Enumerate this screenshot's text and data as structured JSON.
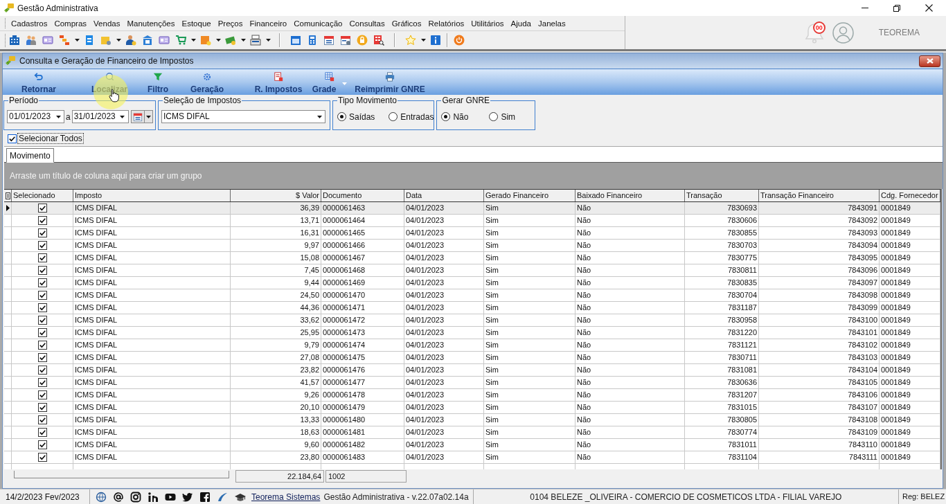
{
  "window": {
    "title": "Gestão Administrativa"
  },
  "menu": [
    "Cadastros",
    "Compras",
    "Vendas",
    "Manutenções",
    "Estoque",
    "Preços",
    "Financeiro",
    "Comunicação",
    "Consultas",
    "Gráficos",
    "Relatórios",
    "Utilitários",
    "Ajuda",
    "Janelas"
  ],
  "notifications": {
    "badge": "00"
  },
  "user": {
    "name": "TEOREMA"
  },
  "form": {
    "title": "Consulta e Geração de Financeiro de Impostos"
  },
  "ribbon": [
    {
      "label": "Retornar",
      "kind": "button"
    },
    {
      "label": "Localizar",
      "kind": "button"
    },
    {
      "label": "Filtro",
      "kind": "button"
    },
    {
      "label": "Geração",
      "kind": "button"
    },
    {
      "label": "R. Impostos",
      "kind": "button"
    },
    {
      "label": "Grade",
      "kind": "dropdown"
    },
    {
      "label": "Reimprimir GNRE",
      "kind": "button"
    }
  ],
  "filters": {
    "period": {
      "label": "Período",
      "from": "01/01/2023",
      "separator": "a",
      "to": "31/01/2023"
    },
    "tax_selection": {
      "label": "Seleção de Impostos",
      "value": "ICMS DIFAL"
    },
    "movement_type": {
      "label": "Tipo Movimento",
      "options": [
        {
          "label": "Saídas",
          "selected": true
        },
        {
          "label": "Entradas",
          "selected": false
        }
      ]
    },
    "generate_gnre": {
      "label": "Gerar GNRE",
      "options": [
        {
          "label": "Não",
          "selected": true
        },
        {
          "label": "Sim",
          "selected": false
        }
      ]
    }
  },
  "select_all": {
    "label": "Selecionar Todos",
    "checked": true
  },
  "tabs": [
    {
      "label": "Movimento",
      "selected": true
    }
  ],
  "group_panel": {
    "hint": "Arraste um título de coluna aqui para criar um grupo"
  },
  "table": {
    "checkbox_column": {
      "label": "Selecionado"
    },
    "columns": [
      {
        "label": "Imposto",
        "kind": "text"
      },
      {
        "label": "$ Valor",
        "kind": "money"
      },
      {
        "label": "Documento",
        "kind": "text"
      },
      {
        "label": "Data",
        "kind": "text"
      },
      {
        "label": "Gerado Financeiro",
        "kind": "text"
      },
      {
        "label": "Baixado Financeiro",
        "kind": "text"
      },
      {
        "label": "Transação",
        "kind": "number"
      },
      {
        "label": "Transação Financeiro",
        "kind": "number"
      },
      {
        "label": "Cdg. Fornecedor",
        "kind": "text"
      }
    ],
    "rows": [
      {
        "selected": true,
        "checked": true,
        "cells": [
          "ICMS DIFAL",
          "36,39",
          "0000061463",
          "04/01/2023",
          "Sim",
          "Não",
          "7830693",
          "7843091",
          "0001849"
        ]
      },
      {
        "selected": false,
        "checked": true,
        "cells": [
          "ICMS DIFAL",
          "13,71",
          "0000061464",
          "04/01/2023",
          "Sim",
          "Não",
          "7830606",
          "7843092",
          "0001849"
        ]
      },
      {
        "selected": false,
        "checked": true,
        "cells": [
          "ICMS DIFAL",
          "16,31",
          "0000061465",
          "04/01/2023",
          "Sim",
          "Não",
          "7830855",
          "7843093",
          "0001849"
        ]
      },
      {
        "selected": false,
        "checked": true,
        "cells": [
          "ICMS DIFAL",
          "9,97",
          "0000061466",
          "04/01/2023",
          "Sim",
          "Não",
          "7830703",
          "7843094",
          "0001849"
        ]
      },
      {
        "selected": false,
        "checked": true,
        "cells": [
          "ICMS DIFAL",
          "15,08",
          "0000061467",
          "04/01/2023",
          "Sim",
          "Não",
          "7830775",
          "7843095",
          "0001849"
        ]
      },
      {
        "selected": false,
        "checked": true,
        "cells": [
          "ICMS DIFAL",
          "7,45",
          "0000061468",
          "04/01/2023",
          "Sim",
          "Não",
          "7830811",
          "7843096",
          "0001849"
        ]
      },
      {
        "selected": false,
        "checked": true,
        "cells": [
          "ICMS DIFAL",
          "9,44",
          "0000061469",
          "04/01/2023",
          "Sim",
          "Não",
          "7830835",
          "7843097",
          "0001849"
        ]
      },
      {
        "selected": false,
        "checked": true,
        "cells": [
          "ICMS DIFAL",
          "24,50",
          "0000061470",
          "04/01/2023",
          "Sim",
          "Não",
          "7830704",
          "7843098",
          "0001849"
        ]
      },
      {
        "selected": false,
        "checked": true,
        "cells": [
          "ICMS DIFAL",
          "44,36",
          "0000061471",
          "04/01/2023",
          "Sim",
          "Não",
          "7831187",
          "7843099",
          "0001849"
        ]
      },
      {
        "selected": false,
        "checked": true,
        "cells": [
          "ICMS DIFAL",
          "33,62",
          "0000061472",
          "04/01/2023",
          "Sim",
          "Não",
          "7830958",
          "7843100",
          "0001849"
        ]
      },
      {
        "selected": false,
        "checked": true,
        "cells": [
          "ICMS DIFAL",
          "25,95",
          "0000061473",
          "04/01/2023",
          "Sim",
          "Não",
          "7831220",
          "7843101",
          "0001849"
        ]
      },
      {
        "selected": false,
        "checked": true,
        "cells": [
          "ICMS DIFAL",
          "9,79",
          "0000061474",
          "04/01/2023",
          "Sim",
          "Não",
          "7831121",
          "7843102",
          "0001849"
        ]
      },
      {
        "selected": false,
        "checked": true,
        "cells": [
          "ICMS DIFAL",
          "27,08",
          "0000061475",
          "04/01/2023",
          "Sim",
          "Não",
          "7830711",
          "7843103",
          "0001849"
        ]
      },
      {
        "selected": false,
        "checked": true,
        "cells": [
          "ICMS DIFAL",
          "23,82",
          "0000061476",
          "04/01/2023",
          "Sim",
          "Não",
          "7831081",
          "7843104",
          "0001849"
        ]
      },
      {
        "selected": false,
        "checked": true,
        "cells": [
          "ICMS DIFAL",
          "41,57",
          "0000061477",
          "04/01/2023",
          "Sim",
          "Não",
          "7830636",
          "7843105",
          "0001849"
        ]
      },
      {
        "selected": false,
        "checked": true,
        "cells": [
          "ICMS DIFAL",
          "9,26",
          "0000061478",
          "04/01/2023",
          "Sim",
          "Não",
          "7831207",
          "7843106",
          "0001849"
        ]
      },
      {
        "selected": false,
        "checked": true,
        "cells": [
          "ICMS DIFAL",
          "20,10",
          "0000061479",
          "04/01/2023",
          "Sim",
          "Não",
          "7831015",
          "7843107",
          "0001849"
        ]
      },
      {
        "selected": false,
        "checked": true,
        "cells": [
          "ICMS DIFAL",
          "13,33",
          "0000061480",
          "04/01/2023",
          "Sim",
          "Não",
          "7830805",
          "7843108",
          "0001849"
        ]
      },
      {
        "selected": false,
        "checked": true,
        "cells": [
          "ICMS DIFAL",
          "18,63",
          "0000061481",
          "04/01/2023",
          "Sim",
          "Não",
          "7830774",
          "7843109",
          "0001849"
        ]
      },
      {
        "selected": false,
        "checked": true,
        "cells": [
          "ICMS DIFAL",
          "9,60",
          "0000061482",
          "04/01/2023",
          "Sim",
          "Não",
          "7831011",
          "7843110",
          "0001849"
        ]
      },
      {
        "selected": false,
        "checked": true,
        "cells": [
          "ICMS DIFAL",
          "23,80",
          "0000061483",
          "04/01/2023",
          "Sim",
          "Não",
          "7831104",
          "7843111",
          "0001849"
        ]
      }
    ]
  },
  "totals": {
    "valor": "22.184,64",
    "documento": "1002"
  },
  "status_bar": {
    "date": "14/2/2023 Fev/2023",
    "link": "Teorema Sistemas",
    "version": "Gestão Administrativa - v.22.07a02.14a",
    "company": "0104 BELEZE _OLIVEIRA - COMERCIO DE COSMETICOS LTDA - FILIAL VAREJO",
    "register": "Reg: BELEZ"
  }
}
